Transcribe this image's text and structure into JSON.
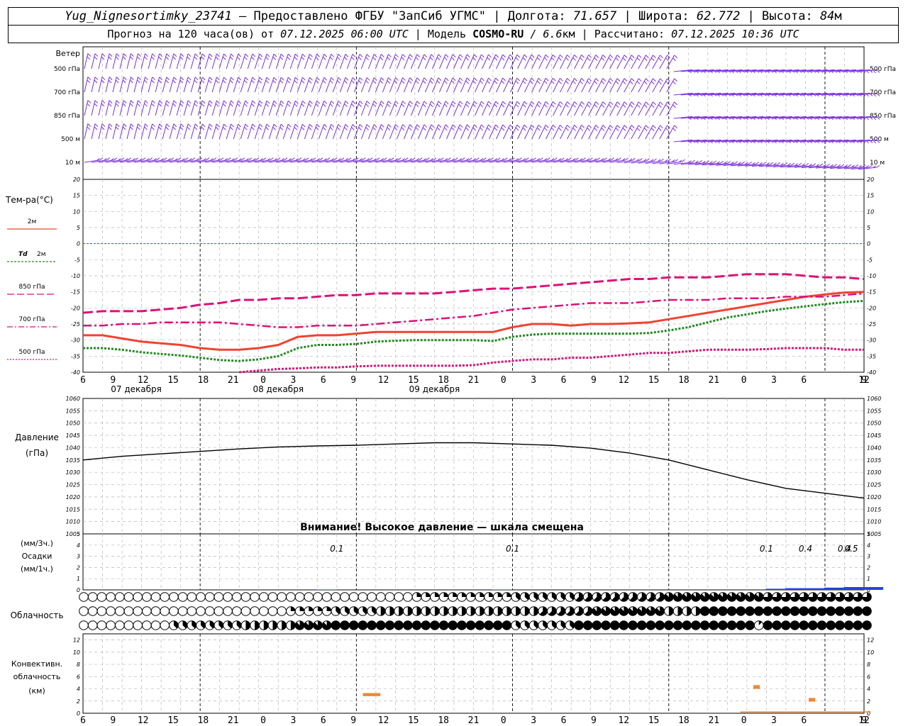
{
  "header": {
    "station": "Yug_Nignesortimky_23741",
    "dash": "—",
    "provided": "Предоставлено ФГБУ \"ЗапСиб УГМС\"",
    "lon_label": "Долгота:",
    "lon": "71.657",
    "lat_label": "Широта:",
    "lat": "62.772",
    "alt_label": "Высота:",
    "alt": "84",
    "alt_unit": "м",
    "forecast_pre": "Прогноз на 120 часа(ов) от",
    "forecast_date": "07.12.2025 06:00 UTC",
    "model_label": "Модель",
    "model": "COSMO-RU",
    "resolution": "/ 6.6",
    "res_unit": "км",
    "calc_label": "Рассчитано:",
    "calc_date": "07.12.2025 10:36 UTC"
  },
  "time_axis": {
    "ticks": [
      "6",
      "9",
      "12",
      "15",
      "18",
      "21",
      "0",
      "3",
      "6",
      "9",
      "12",
      "15",
      "18",
      "21",
      "0",
      "3",
      "6",
      "9",
      "12",
      "15",
      "18",
      "21",
      "0",
      "3",
      "6",
      "9",
      "12"
    ],
    "day_labels": [
      "07 декабря",
      "08 декабря",
      "09 декабря"
    ]
  },
  "labels": {
    "wind_title": "Ветер",
    "wind_levels": [
      "500 гПа",
      "700 гПа",
      "850 гПа",
      "500 м",
      "10 м"
    ],
    "temp_title": "Тем-ра(°C)",
    "legend_t2": "2м",
    "legend_td_a": "Td",
    "legend_td_b": "2м",
    "legend_850": "850 гПа",
    "legend_700": "700 гПа",
    "legend_500": "500 гПа",
    "pressure_title": "Давление",
    "pressure_unit": "(гПа)",
    "pressure_warning": "Внимание! Высокое давление — шкала смещена",
    "precip_unit3": "(мм/3ч.)",
    "precip_title": "Осадки",
    "precip_unit1": "(мм/1ч.)",
    "cloud_title": "Облачность",
    "conv_title_1": "Конвективн.",
    "conv_title_2": "облачность",
    "conv_unit": "(км)"
  },
  "colors": {
    "wind": "#7a2ee0",
    "t2": "#ee4433",
    "td": "#228b22",
    "t850": "#dd1177",
    "t700": "#dd1177",
    "t500": "#dd1177",
    "precip": "#2244dd",
    "conv": "#ee8833",
    "zero_line": "#3355ff"
  },
  "chart_data": [
    {
      "type": "wind_barbs",
      "levels": [
        "500 гПа",
        "700 гПа",
        "850 гПа",
        "500 м",
        "10 м"
      ],
      "x_hours": [
        0,
        120
      ],
      "barbs_per_row": 110
    },
    {
      "type": "line",
      "title": "Тем-ра(°C)",
      "ylim": [
        -40,
        20
      ],
      "yticks": [
        20,
        15,
        10,
        5,
        0,
        -5,
        -10,
        -15,
        -20,
        -25,
        -30,
        -35,
        -40
      ],
      "x": [
        0,
        3,
        6,
        9,
        12,
        15,
        18,
        21,
        24,
        27,
        30,
        33,
        36,
        39,
        42,
        45,
        48,
        51,
        54,
        57,
        60,
        63,
        66,
        69,
        72,
        75,
        78,
        81,
        84,
        87,
        90,
        93,
        96,
        99,
        102,
        105,
        108,
        111,
        114,
        117,
        120
      ],
      "series": [
        {
          "name": "2м",
          "style": "solid",
          "values": [
            -28.5,
            -28.5,
            -29.5,
            -30.5,
            -31,
            -31.5,
            -32.5,
            -33,
            -33,
            -32.5,
            -31.5,
            -29,
            -28.5,
            -28.5,
            -28,
            -27.5,
            -27.5,
            -27.5,
            -27.5,
            -27.5,
            -27.5,
            -27.5,
            -26,
            -25,
            -25,
            -25.5,
            -25,
            -25,
            -24.8,
            -24.5,
            -23.5,
            -22.5,
            -21.5,
            -20.5,
            -19.5,
            -18.5,
            -17.5,
            -16.5,
            -15.8,
            -15.2,
            -15
          ]
        },
        {
          "name": "Td 2м",
          "style": "dot",
          "values": [
            -32.5,
            -32.5,
            -33,
            -33.8,
            -34.3,
            -34.8,
            -35.5,
            -36.2,
            -36.5,
            -36,
            -35,
            -32.5,
            -31.5,
            -31.5,
            -31.2,
            -30.5,
            -30.2,
            -30,
            -30,
            -30,
            -30,
            -30.3,
            -29,
            -28.3,
            -28,
            -28,
            -28,
            -28,
            -28,
            -27.8,
            -27,
            -26,
            -24.5,
            -23,
            -22,
            -21,
            -20.2,
            -19.5,
            -18.8,
            -18.2,
            -17.8
          ]
        },
        {
          "name": "850 гПа",
          "style": "dash",
          "values": [
            -21.5,
            -21,
            -21,
            -21,
            -20.5,
            -20,
            -19,
            -18.5,
            -17.5,
            -17.5,
            -17,
            -17,
            -16.5,
            -16,
            -16,
            -15.5,
            -15.5,
            -15.5,
            -15.5,
            -15,
            -14.5,
            -14,
            -14,
            -13.5,
            -13,
            -12.5,
            -12,
            -11.5,
            -11,
            -11,
            -10.5,
            -10.5,
            -10.5,
            -10,
            -9.5,
            -9.5,
            -9.5,
            -10,
            -10.5,
            -10.5,
            -11
          ]
        },
        {
          "name": "700 гПа",
          "style": "dashdot",
          "values": [
            -25.5,
            -25.5,
            -25,
            -25,
            -24.5,
            -24.5,
            -24.5,
            -24.5,
            -25,
            -25.5,
            -26,
            -26,
            -25.5,
            -25.5,
            -25.5,
            -25,
            -24.5,
            -24,
            -23.5,
            -23,
            -22.5,
            -21.5,
            -20.5,
            -20,
            -19.5,
            -19,
            -18.5,
            -18.5,
            -18.5,
            -18,
            -17.5,
            -17.5,
            -17.5,
            -17,
            -17,
            -17,
            -16.5,
            -16.5,
            -16.5,
            -16,
            -15.5
          ]
        },
        {
          "name": "500 гПа",
          "style": "dot",
          "values": [
            null,
            null,
            null,
            null,
            null,
            null,
            null,
            null,
            -40,
            -39.5,
            -39,
            -38.8,
            -38.5,
            -38.5,
            -38.2,
            -38,
            -38,
            -38,
            -38,
            -38,
            -37.8,
            -37,
            -36.5,
            -36,
            -36,
            -35.5,
            -35.5,
            -35,
            -34.5,
            -34,
            -34,
            -33.5,
            -33,
            -33,
            -33,
            -32.8,
            -32.5,
            -32.5,
            -32.5,
            -33,
            -33
          ]
        }
      ]
    },
    {
      "type": "line",
      "title": "Давление",
      "ylabel": "(гПа)",
      "ylim": [
        1005,
        1060
      ],
      "yticks": [
        1060,
        1055,
        1050,
        1045,
        1040,
        1035,
        1030,
        1025,
        1020,
        1015,
        1010,
        1005
      ],
      "x": [
        0,
        6,
        12,
        18,
        24,
        30,
        36,
        42,
        48,
        54,
        60,
        66,
        72,
        78,
        84,
        90,
        96,
        102,
        108,
        114,
        120
      ],
      "values": [
        1035,
        1036.5,
        1037.5,
        1038.5,
        1039.5,
        1040.3,
        1040.7,
        1041,
        1041.5,
        1042,
        1042,
        1041.5,
        1041,
        1039.8,
        1037.8,
        1035,
        1031,
        1027,
        1023.5,
        1021.5,
        1019.5
      ]
    },
    {
      "type": "bar",
      "title": "Осадки",
      "ylim": [
        0,
        5
      ],
      "yticks": [
        5,
        4,
        3,
        2,
        1,
        0
      ],
      "x": [
        36,
        63,
        105,
        108,
        111,
        114,
        117,
        120
      ],
      "values": [
        0.03,
        0.03,
        0.1,
        0.15,
        0.15,
        0.2,
        0.25,
        0.25
      ],
      "annotations": [
        {
          "x": 39,
          "text": "0.1"
        },
        {
          "x": 66,
          "text": "0.1"
        },
        {
          "x": 105,
          "text": "0.1"
        },
        {
          "x": 111,
          "text": "0.4"
        },
        {
          "x": 117,
          "text": "0.4"
        },
        {
          "x": 123,
          "text": "0.5"
        }
      ]
    },
    {
      "type": "cloud_symbols",
      "title": "Облачность",
      "rows": [
        {
          "level": "high",
          "okta_segments": [
            [
              0,
              50,
              0
            ],
            [
              50,
              66,
              2
            ],
            [
              66,
              75,
              3
            ],
            [
              75,
              90,
              5
            ],
            [
              90,
              105,
              7
            ],
            [
              105,
              122,
              6
            ]
          ]
        },
        {
          "level": "middle",
          "okta_segments": [
            [
              0,
              31,
              0
            ],
            [
              31,
              38,
              2
            ],
            [
              38,
              45,
              3
            ],
            [
              45,
              60,
              4
            ],
            [
              60,
              70,
              4
            ],
            [
              70,
              78,
              5
            ],
            [
              78,
              90,
              7
            ],
            [
              90,
              95,
              4
            ],
            [
              95,
              122,
              8
            ]
          ]
        },
        {
          "level": "low",
          "okta_segments": [
            [
              0,
              13,
              0
            ],
            [
              13,
              24,
              3
            ],
            [
              24,
              32,
              4
            ],
            [
              32,
              38,
              7
            ],
            [
              38,
              66,
              8
            ],
            [
              66,
              75,
              3
            ],
            [
              75,
              90,
              8
            ],
            [
              90,
              103,
              8
            ],
            [
              103,
              105,
              1
            ],
            [
              105,
              122,
              8
            ]
          ]
        }
      ]
    },
    {
      "type": "bar",
      "title": "Конвективн. облачность",
      "ylabel": "(км)",
      "ylim": [
        0,
        13
      ],
      "yticks": [
        12,
        10,
        8,
        6,
        4,
        2,
        0
      ],
      "segments": [
        {
          "x0": 43,
          "x1": 45.7,
          "base": 2.8,
          "top": 3.3
        },
        {
          "x0": 103,
          "x1": 104,
          "base": 4.0,
          "top": 4.6
        },
        {
          "x0": 111.5,
          "x1": 112.5,
          "base": 1.9,
          "top": 2.5
        },
        {
          "x0": 101,
          "x1": 121,
          "base": 0.15,
          "top": 0.3
        }
      ]
    }
  ]
}
